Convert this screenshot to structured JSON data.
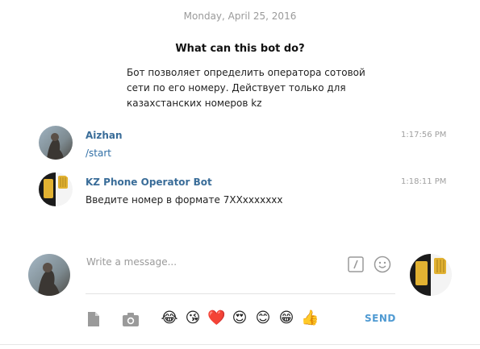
{
  "date": "Monday, April 25, 2016",
  "bot_info": {
    "title": "What can this bot do?",
    "description": "Бот позволяет определить оператора сотовой сети по его номеру. Действует только для казахстанских номеров kz"
  },
  "messages": [
    {
      "sender": "Aizhan",
      "time": "1:17:56 PM",
      "text": "/start"
    },
    {
      "sender": "KZ Phone Operator Bot",
      "time": "1:18:11 PM",
      "text": "Введите номер в формате 7XXxxxxxxx"
    }
  ],
  "composer": {
    "placeholder": "Write a message...",
    "send_label": "SEND",
    "emojis": [
      "😂",
      "😘",
      "❤️",
      "😍",
      "😊",
      "😁",
      "👍"
    ]
  },
  "colors": {
    "name": "#3a6d99",
    "send": "#4f9ad2",
    "command": "#2f6ea5",
    "timestamp": "#a0a0a0"
  },
  "icons": [
    "slash-command-icon",
    "emoji-icon",
    "attach-file-icon",
    "camera-icon"
  ]
}
